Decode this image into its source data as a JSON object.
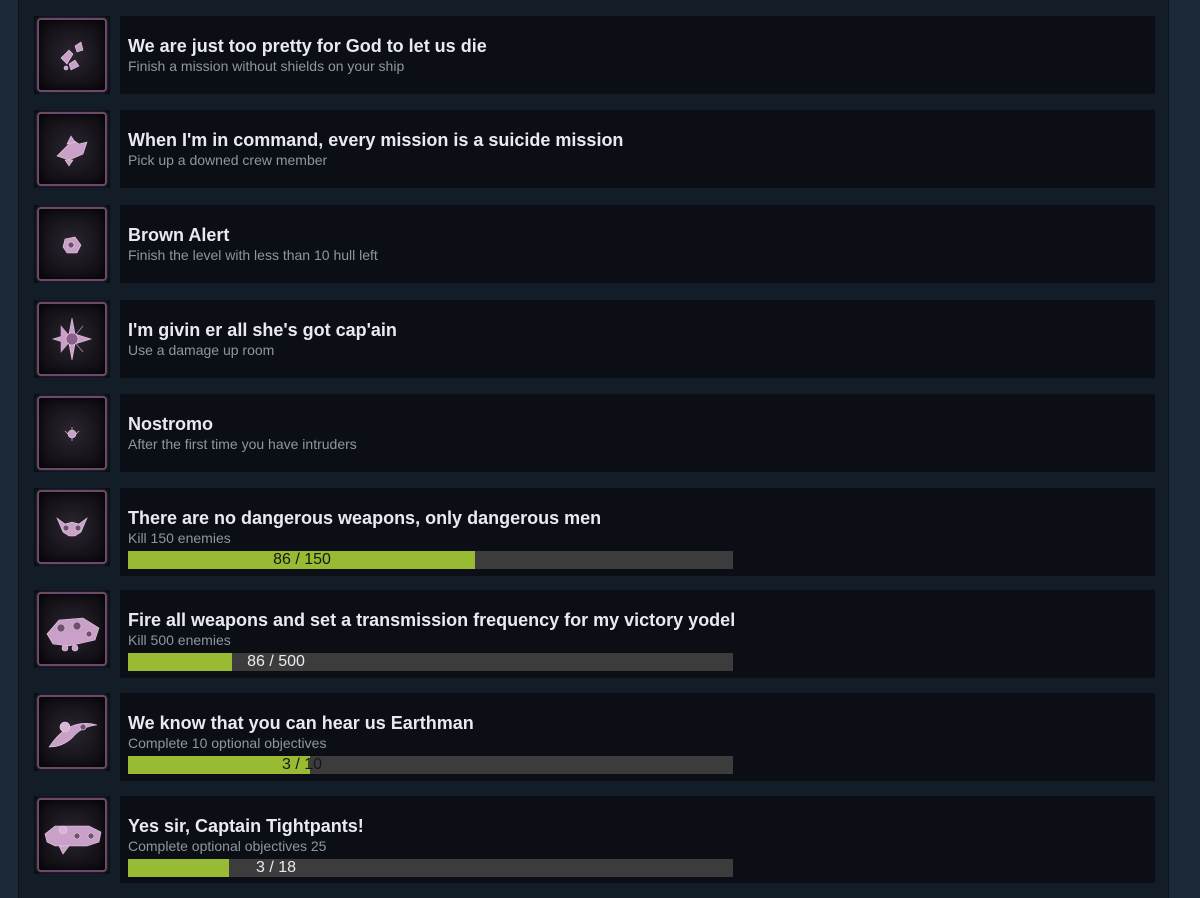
{
  "achievements": [
    {
      "title": "We are just too pretty for God to let us die",
      "description": "Finish a mission without shields on your ship",
      "icon": "ship-debris-icon"
    },
    {
      "title": "When I'm in command, every mission is a suicide mission",
      "description": "Pick up a downed crew member",
      "icon": "crew-pickup-icon"
    },
    {
      "title": "Brown Alert",
      "description": "Finish the level with less than 10 hull left",
      "icon": "damaged-hull-icon"
    },
    {
      "title": "I'm givin er all she's got cap'ain",
      "description": "Use a damage up room",
      "icon": "burst-icon"
    },
    {
      "title": "Nostromo",
      "description": "After the first time you have intruders",
      "icon": "intruder-icon"
    },
    {
      "title": "There are no dangerous weapons, only dangerous men",
      "description": "Kill 150 enemies",
      "icon": "enemy-ship-icon",
      "progress": {
        "text": "86 / 150",
        "current": 86,
        "total": 150
      }
    },
    {
      "title": "Fire all weapons and set a transmission frequency for my victory yodel",
      "description": "Kill 500 enemies",
      "icon": "battleship-icon",
      "progress": {
        "text": "86 / 500",
        "current": 86,
        "total": 500
      }
    },
    {
      "title": "We know that you can hear us Earthman",
      "description": "Complete 10 optional objectives",
      "icon": "crescent-ship-icon",
      "progress": {
        "text": "3 / 10",
        "current": 3,
        "total": 10
      }
    },
    {
      "title": "Yes sir, Captain Tightpants!",
      "description": "Complete optional objectives 25",
      "icon": "cruiser-icon",
      "progress": {
        "text": "3 / 18",
        "current": 3,
        "total": 18
      }
    }
  ],
  "colors": {
    "page_background": "#1b2838",
    "card_background": "#0b0f15",
    "progress_fill": "#99bb33",
    "progress_track": "#3c3c3c",
    "icon_frame": "#6a4a68"
  }
}
